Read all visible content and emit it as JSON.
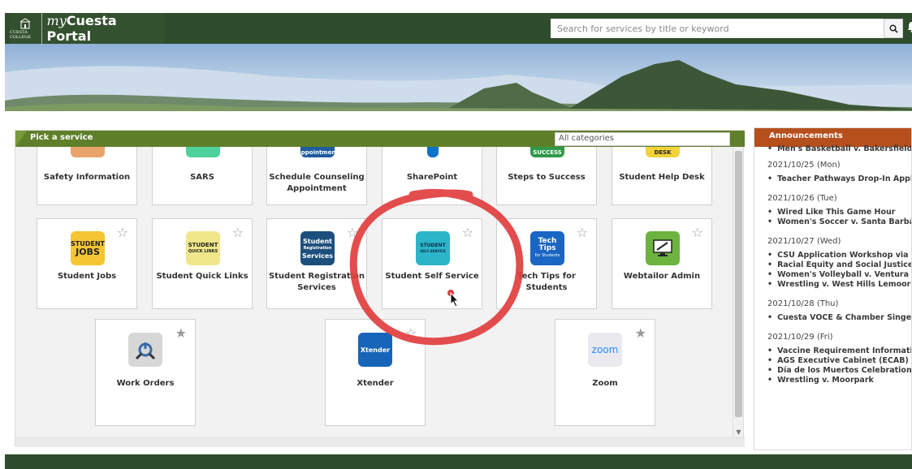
{
  "header": {
    "brand_college": "CUESTA COLLEGE",
    "brand_my": "my",
    "brand_rest": "Cuesta Portal",
    "search_placeholder": "Search for services by title or keyword"
  },
  "service_panel": {
    "title": "Pick a service",
    "category": "All categories"
  },
  "tiles_row1": [
    {
      "label": "Safety Information"
    },
    {
      "label": "SARS"
    },
    {
      "label": "Schedule Counseling Appointment",
      "icon_text": "Appointment"
    },
    {
      "label": "SharePoint"
    },
    {
      "label": "Steps to Success",
      "icon_text": "SUCCESS"
    },
    {
      "label": "Student Help Desk",
      "icon_text": "DESK"
    }
  ],
  "tiles_row2": [
    {
      "label": "Student Jobs",
      "icon_line1": "STUDENT",
      "icon_line2": "JOBS"
    },
    {
      "label": "Student Quick Links",
      "icon_line1": "STUDENT",
      "icon_line2": "QUICK LINKS"
    },
    {
      "label": "Student Registration Services",
      "icon_line1": "Student",
      "icon_line2": "Registration",
      "icon_line3": "Services"
    },
    {
      "label": "Student Self Service",
      "icon_line1": "STUDENT",
      "icon_line2": "SELF-SERVICE"
    },
    {
      "label": "Tech Tips for Students",
      "icon_line1": "Tech",
      "icon_line2": "Tips",
      "icon_line3": "for Students"
    },
    {
      "label": "Webtailor Admin"
    }
  ],
  "tiles_row3": [
    {
      "label": "Work Orders"
    },
    {
      "label": "Xtender",
      "icon_text": "Xtender"
    },
    {
      "label": "Zoom",
      "icon_text": "zoom"
    }
  ],
  "announcements": {
    "title": "Announcements",
    "top_item": "Men's Basketball v. Bakersfield",
    "groups": [
      {
        "date": "2021/10/25 (Mon)",
        "items": [
          "Teacher Pathways Drop-In Appli"
        ]
      },
      {
        "date": "2021/10/26 (Tue)",
        "items": [
          "Wired Like This Game Hour",
          "Women's Soccer v. Santa Barbar"
        ]
      },
      {
        "date": "2021/10/27 (Wed)",
        "items": [
          "CSU Application Workshop via Z",
          "Racial Equity and Social Justice i",
          "Women's Volleyball v. Ventura",
          "Wrestling v. West Hills Lemoore"
        ]
      },
      {
        "date": "2021/10/28 (Thu)",
        "items": [
          "Cuesta VOCE & Chamber Singers"
        ]
      },
      {
        "date": "2021/10/29 (Fri)",
        "items": [
          "Vaccine Requirement Informatio",
          "AGS Executive Cabinet (ECAB) M",
          "Día de los Muertos Celebration (",
          "Wrestling v. Moorpark"
        ]
      }
    ]
  },
  "colors": {
    "header_green": "#2f4c2c",
    "panel_green": "#5f7f2a",
    "announce_orange": "#b5501d",
    "annotation_red": "#e03a3a"
  }
}
